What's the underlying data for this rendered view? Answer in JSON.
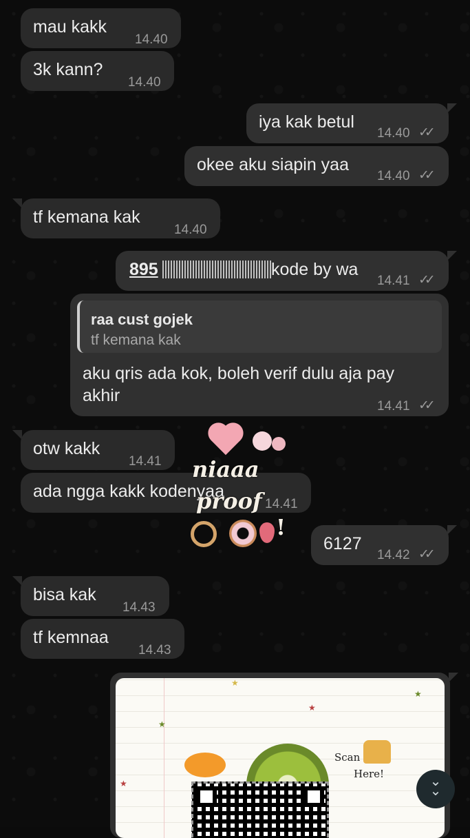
{
  "messages": [
    {
      "text": "mau kakk",
      "time": "14.40"
    },
    {
      "text": "3k kann?",
      "time": "14.40"
    },
    {
      "text": "iya kak betul",
      "time": "14.40"
    },
    {
      "text": "okee aku siapin yaa",
      "time": "14.40"
    },
    {
      "text": "tf kemana kak",
      "time": "14.40"
    },
    {
      "text_prefix": "895",
      "text_suffix": "kode by wa",
      "time": "14.41"
    },
    {
      "reply_name": "raa cust gojek",
      "reply_text": "tf kemana kak",
      "line1": "aku qris ada kok, boleh verif dulu aja pay",
      "line2": "akhir",
      "time": "14.41"
    },
    {
      "text": "otw kakk",
      "time": "14.41"
    },
    {
      "text": "ada ngga kakk kodenyaa",
      "time": "14.41"
    },
    {
      "text": "6127",
      "time": "14.42"
    },
    {
      "text": "bisa kak",
      "time": "14.43"
    },
    {
      "text": "tf kemnaa",
      "time": "14.43"
    }
  ],
  "ticks": "✓✓",
  "sticker": {
    "line1": "niaaa",
    "line2": "proof",
    "line3": "!"
  },
  "image": {
    "scan": "Scan",
    "here": "Here!"
  },
  "scroll_icon_line1": "⌄",
  "scroll_icon_line2": "⌄",
  "colors": {
    "bg": "#0c0c0c",
    "bubble_in": "#2a2a2a",
    "bubble_out": "#303030",
    "text": "#ececec",
    "time": "#9a9a9a"
  }
}
